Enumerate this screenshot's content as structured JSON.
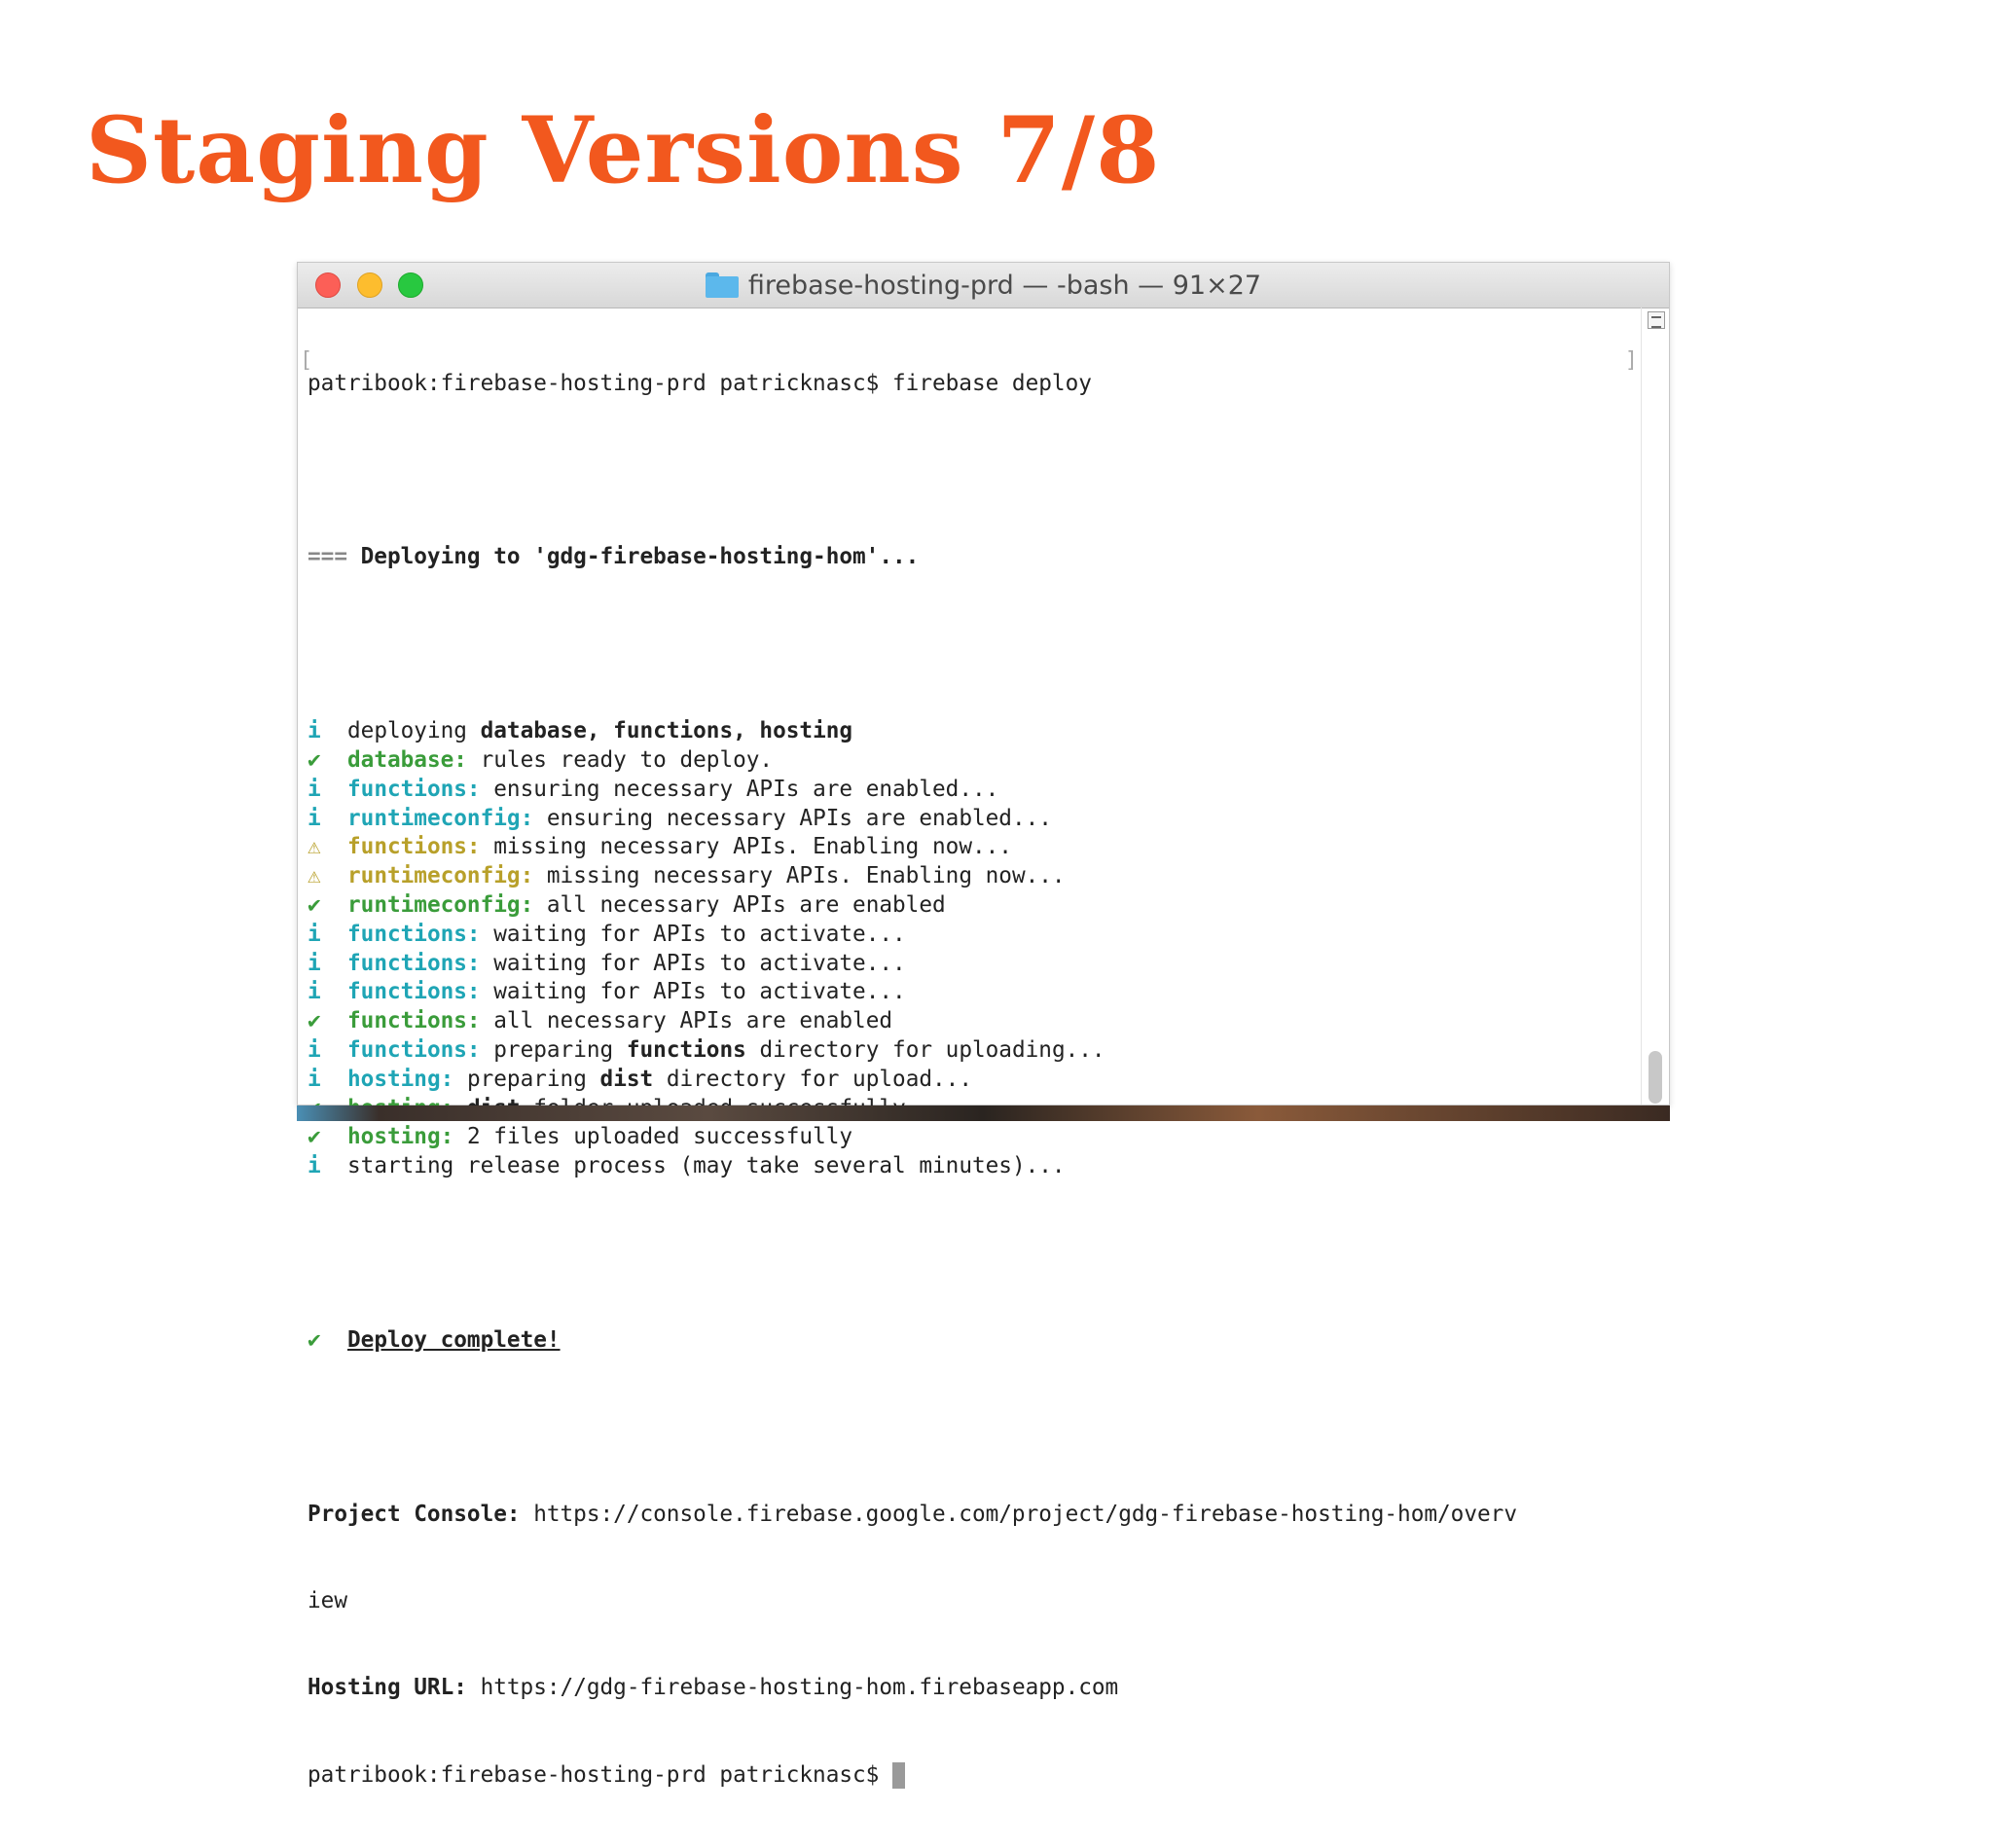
{
  "slide": {
    "title": "Staging Versions 7/8"
  },
  "window": {
    "title": "firebase-hosting-prd — -bash — 91×27"
  },
  "terminal": {
    "prompt_line": "patribook:firebase-hosting-prd patricknasc$ firebase deploy",
    "deploying_header": "=== Deploying to 'gdg-firebase-hosting-hom'...",
    "lines": [
      {
        "icon": "i",
        "tone": "cyan",
        "parts": [
          [
            "",
            "deploying "
          ],
          [
            "bold",
            "database, functions, hosting"
          ]
        ]
      },
      {
        "icon": "✔",
        "tone": "green",
        "parts": [
          [
            "green",
            "database:"
          ],
          [
            "",
            " rules ready to deploy."
          ]
        ]
      },
      {
        "icon": "i",
        "tone": "cyan",
        "parts": [
          [
            "cyan",
            "functions:"
          ],
          [
            "",
            " ensuring necessary APIs are enabled..."
          ]
        ]
      },
      {
        "icon": "i",
        "tone": "cyan",
        "parts": [
          [
            "cyan",
            "runtimeconfig:"
          ],
          [
            "",
            " ensuring necessary APIs are enabled..."
          ]
        ]
      },
      {
        "icon": "⚠",
        "tone": "yellow",
        "parts": [
          [
            "yellow",
            "functions:"
          ],
          [
            "",
            " missing necessary APIs. Enabling now..."
          ]
        ]
      },
      {
        "icon": "⚠",
        "tone": "yellow",
        "parts": [
          [
            "yellow",
            "runtimeconfig:"
          ],
          [
            "",
            " missing necessary APIs. Enabling now..."
          ]
        ]
      },
      {
        "icon": "✔",
        "tone": "green",
        "parts": [
          [
            "green",
            "runtimeconfig:"
          ],
          [
            "",
            " all necessary APIs are enabled"
          ]
        ]
      },
      {
        "icon": "i",
        "tone": "cyan",
        "parts": [
          [
            "cyan",
            "functions:"
          ],
          [
            "",
            " waiting for APIs to activate..."
          ]
        ]
      },
      {
        "icon": "i",
        "tone": "cyan",
        "parts": [
          [
            "cyan",
            "functions:"
          ],
          [
            "",
            " waiting for APIs to activate..."
          ]
        ]
      },
      {
        "icon": "i",
        "tone": "cyan",
        "parts": [
          [
            "cyan",
            "functions:"
          ],
          [
            "",
            " waiting for APIs to activate..."
          ]
        ]
      },
      {
        "icon": "✔",
        "tone": "green",
        "parts": [
          [
            "green",
            "functions:"
          ],
          [
            "",
            " all necessary APIs are enabled"
          ]
        ]
      },
      {
        "icon": "i",
        "tone": "cyan",
        "parts": [
          [
            "cyan",
            "functions:"
          ],
          [
            "",
            " preparing "
          ],
          [
            "bold",
            "functions"
          ],
          [
            "",
            " directory for uploading..."
          ]
        ]
      },
      {
        "icon": "i",
        "tone": "cyan",
        "parts": [
          [
            "cyan",
            "hosting:"
          ],
          [
            "",
            " preparing "
          ],
          [
            "bold",
            "dist"
          ],
          [
            "",
            " directory for upload..."
          ]
        ]
      },
      {
        "icon": "✔",
        "tone": "green",
        "parts": [
          [
            "green",
            "hosting:"
          ],
          [
            "",
            " "
          ],
          [
            "bold",
            "dist"
          ],
          [
            "",
            " folder uploaded successfully"
          ]
        ]
      },
      {
        "icon": "✔",
        "tone": "green",
        "parts": [
          [
            "green",
            "hosting:"
          ],
          [
            "",
            " 2 files uploaded successfully"
          ]
        ]
      },
      {
        "icon": "i",
        "tone": "cyan",
        "parts": [
          [
            "",
            "starting release process (may take several minutes)..."
          ]
        ]
      }
    ],
    "complete_icon": "✔",
    "complete_text": "Deploy complete!",
    "console_label": "Project Console:",
    "console_url_1": " https://console.firebase.google.com/project/gdg-firebase-hosting-hom/overv",
    "console_url_2": "iew",
    "hosting_label": "Hosting URL:",
    "hosting_url": " https://gdg-firebase-hosting-hom.firebaseapp.com",
    "final_prompt": "patribook:firebase-hosting-prd patricknasc$ "
  },
  "colors": {
    "title": "#f2581e",
    "info": "#1fa5b5",
    "success": "#3a9c3a",
    "warning": "#b8a02a"
  },
  "icons": {
    "info": "info-icon",
    "success": "checkmark-icon",
    "warning": "warning-icon",
    "folder": "folder-icon"
  }
}
